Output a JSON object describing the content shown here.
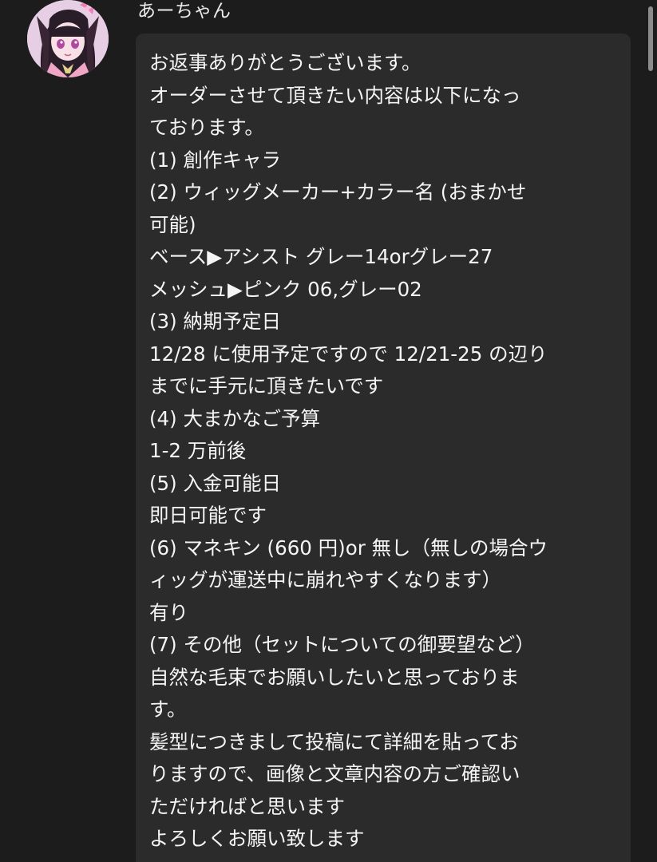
{
  "message": {
    "sender_name": "あーちゃん",
    "avatar": "user-avatar-anime-girl",
    "lines": [
      "お返事ありがとうございます。",
      "オーダーさせて頂きたい内容は以下になっ",
      "ております。",
      "(1) 創作キャラ",
      "(2) ウィッグメーカー+カラー名 (おまかせ",
      "可能)",
      "ベース▶︎アシスト グレー14orグレー27",
      "メッシュ▶︎ピンク 06,グレー02",
      "(3) 納期予定日",
      "12/28 に使用予定ですので 12/21-25 の辺り",
      "までに手元に頂きたいです",
      "(4) 大まかなご予算",
      "1-2 万前後",
      "(5) 入金可能日",
      "即日可能です",
      "(6) マネキン (660 円)or 無し（無しの場合ウ",
      "ィッグが運送中に崩れやすくなります）",
      "有り",
      "(7) その他（セットについての御要望など）",
      "自然な毛束でお願いしたいと思っておりま",
      "す。",
      "髪型につきまして投稿にて詳細を貼ってお",
      "りますので、画像と文章内容の方ご確認い",
      "ただければと思います",
      "よろしくお願い致します"
    ]
  },
  "colors": {
    "background": "#1c1c1c",
    "bubble": "#2b2b2b",
    "text": "#f5f5f5",
    "scrollbar": "#8c8c8c"
  }
}
